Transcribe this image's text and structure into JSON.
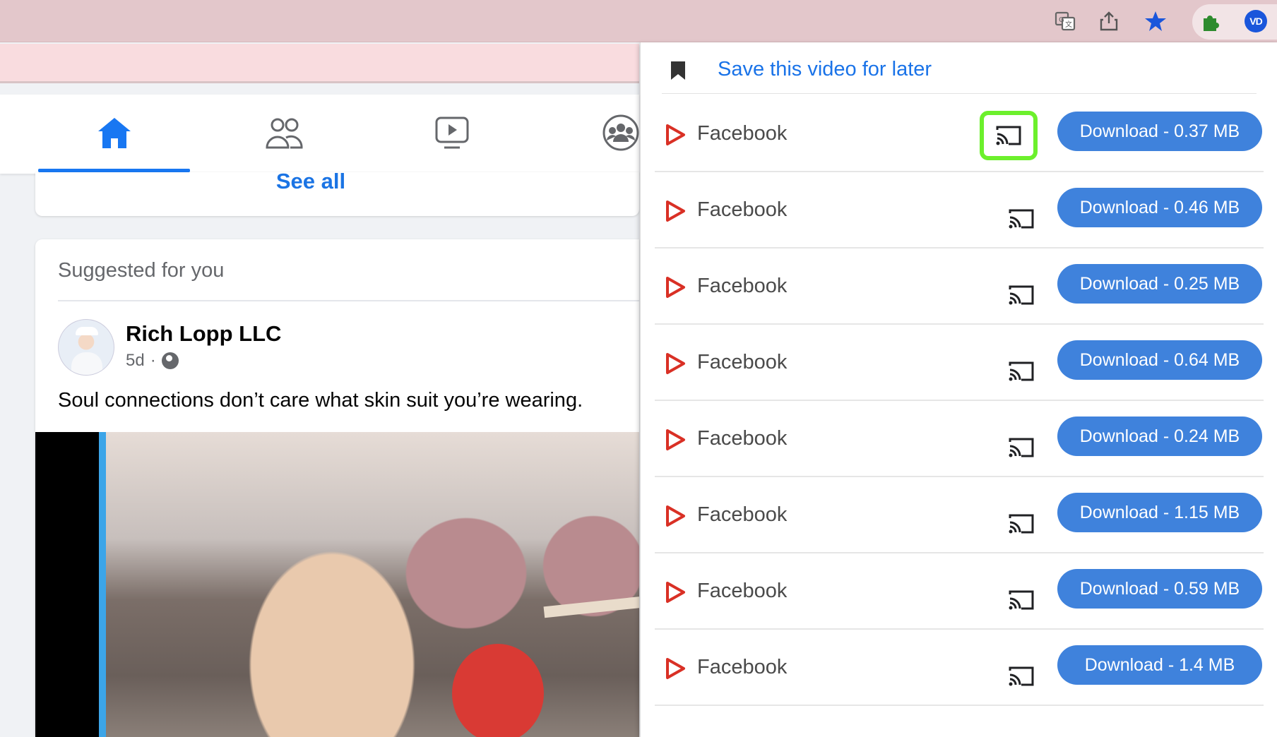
{
  "browser": {
    "icons": [
      "translate-icon",
      "share-icon",
      "star-icon",
      "extensions-icon"
    ],
    "profile_initials": "VD"
  },
  "facebook": {
    "nav": [
      "home-icon",
      "friends-icon",
      "watch-icon",
      "groups-icon"
    ],
    "see_all": "See all",
    "suggested_header": "Suggested for you",
    "post": {
      "author": "Rich Lopp LLC",
      "time": "5d",
      "separator": "·",
      "caption": "Soul connections don’t care what skin suit you’re wearing."
    }
  },
  "popup": {
    "save_label": "Save this video for later",
    "videos": [
      {
        "source": "Facebook",
        "download": "Download - 0.37 MB"
      },
      {
        "source": "Facebook",
        "download": "Download - 0.46 MB"
      },
      {
        "source": "Facebook",
        "download": "Download - 0.25 MB"
      },
      {
        "source": "Facebook",
        "download": "Download - 0.64 MB"
      },
      {
        "source": "Facebook",
        "download": "Download - 0.24 MB"
      },
      {
        "source": "Facebook",
        "download": "Download - 1.15 MB"
      },
      {
        "source": "Facebook",
        "download": "Download - 0.59 MB"
      },
      {
        "source": "Facebook",
        "download": "Download - 1.4 MB"
      }
    ]
  },
  "colors": {
    "facebook_blue": "#1877f2",
    "download_blue": "#3f82dc",
    "play_red": "#d93025",
    "cast_highlight": "#6cf02c",
    "toolbar_bg": "#e3c7cb"
  }
}
